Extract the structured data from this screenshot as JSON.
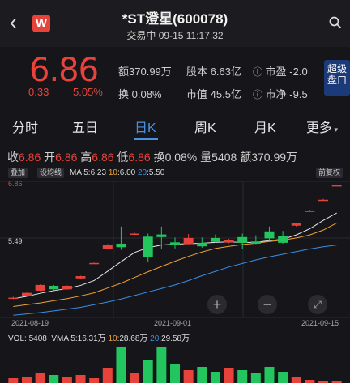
{
  "header": {
    "title": "*ST澄星(600078)",
    "subtitle": "交易中 09-15 11:17:32",
    "logo_text": "W"
  },
  "quote": {
    "price": "6.86",
    "change": "0.33",
    "change_pct": "5.05%",
    "amount_label": "额",
    "amount": "370.99万",
    "share_label": "股本",
    "shares": "6.63亿",
    "pe_label": "市盈",
    "pe": "-2.0",
    "turnover_label": "换",
    "turnover": "0.08%",
    "mcap_label": "市值",
    "mcap": "45.5亿",
    "pb_label": "市净",
    "pb": "-9.5",
    "margin_button": "超级盘口",
    "price_color": "#e8433b"
  },
  "tabs": [
    "分时",
    "五日",
    "日K",
    "周K",
    "月K",
    "更多"
  ],
  "active_tab": "日K",
  "ohlc": {
    "close_label": "收",
    "close": "6.86",
    "open_label": "开",
    "open": "6.86",
    "high_label": "高",
    "high": "6.86",
    "low_label": "低",
    "low": "6.86",
    "turnover_label": "换",
    "turnover": "0.08%",
    "volume_label": "量",
    "volume": "5408",
    "amount_label": "额",
    "amount": "370.99万"
  },
  "ma": {
    "chip1": "叠加",
    "chip2": "设均线",
    "label": "MA",
    "ma5_label": "5",
    "ma5": "6.23",
    "ma10_label": "10",
    "ma10": "6.00",
    "ma20_label": "20",
    "ma20": "5.50",
    "adjust": "前复权",
    "ma5_color": "#e8e8e8",
    "ma10_color": "#f0a030",
    "ma20_color": "#3a8ee6"
  },
  "chart_data": {
    "type": "candlestick",
    "y_labels": [
      "6.86",
      "5.49"
    ],
    "x_labels": [
      "2021-08-19",
      "2021-09-01",
      "2021-09-15"
    ],
    "candles": [
      {
        "o": 4.3,
        "c": 4.3,
        "h": 4.32,
        "l": 4.28
      },
      {
        "o": 4.33,
        "c": 4.41,
        "h": 4.42,
        "l": 4.32
      },
      {
        "o": 4.46,
        "c": 4.59,
        "h": 4.6,
        "l": 4.45
      },
      {
        "o": 4.57,
        "c": 4.49,
        "h": 4.59,
        "l": 4.47
      },
      {
        "o": 4.49,
        "c": 4.57,
        "h": 4.58,
        "l": 4.48
      },
      {
        "o": 4.74,
        "c": 4.79,
        "h": 4.8,
        "l": 4.73
      },
      {
        "o": 5.09,
        "c": 5.09,
        "h": 5.1,
        "l": 5.08
      },
      {
        "o": 5.4,
        "c": 5.51,
        "h": 5.52,
        "l": 5.4
      },
      {
        "o": 5.53,
        "c": 5.45,
        "h": 5.92,
        "l": 5.39
      },
      {
        "o": 5.76,
        "c": 5.76,
        "h": 5.78,
        "l": 5.74
      },
      {
        "o": 5.69,
        "c": 5.22,
        "h": 5.76,
        "l": 5.12
      },
      {
        "o": 5.74,
        "c": 5.68,
        "h": 5.92,
        "l": 5.4
      },
      {
        "o": 5.56,
        "c": 5.5,
        "h": 5.67,
        "l": 5.42
      },
      {
        "o": 5.52,
        "c": 5.66,
        "h": 5.75,
        "l": 5.5
      },
      {
        "o": 5.55,
        "c": 5.47,
        "h": 5.67,
        "l": 5.44
      },
      {
        "o": 5.66,
        "c": 5.57,
        "h": 5.74,
        "l": 5.55
      },
      {
        "o": 5.56,
        "c": 5.62,
        "h": 5.64,
        "l": 5.54
      },
      {
        "o": 5.68,
        "c": 5.55,
        "h": 5.76,
        "l": 5.4
      },
      {
        "o": 5.58,
        "c": 5.53,
        "h": 5.72,
        "l": 5.52
      },
      {
        "o": 5.81,
        "c": 5.65,
        "h": 5.92,
        "l": 5.6
      },
      {
        "o": 5.7,
        "c": 5.55,
        "h": 5.82,
        "l": 5.53
      },
      {
        "o": 5.94,
        "c": 5.99,
        "h": 6.0,
        "l": 5.92
      },
      {
        "o": 6.28,
        "c": 6.28,
        "h": 6.3,
        "l": 6.27
      },
      {
        "o": 6.53,
        "c": 6.53,
        "h": 6.55,
        "l": 6.52
      },
      {
        "o": 6.86,
        "c": 6.86,
        "h": 6.86,
        "l": 6.86
      }
    ],
    "ma5": [
      4.28,
      4.33,
      4.4,
      4.46,
      4.51,
      4.58,
      4.69,
      4.9,
      5.12,
      5.33,
      5.44,
      5.5,
      5.52,
      5.53,
      5.54,
      5.56,
      5.57,
      5.56,
      5.56,
      5.6,
      5.63,
      5.73,
      5.87,
      6.06,
      6.23
    ],
    "ma10": [
      4.1,
      4.14,
      4.18,
      4.23,
      4.28,
      4.34,
      4.41,
      4.52,
      4.63,
      4.76,
      4.89,
      5.01,
      5.13,
      5.24,
      5.34,
      5.42,
      5.47,
      5.51,
      5.54,
      5.58,
      5.61,
      5.66,
      5.73,
      5.84,
      6.0
    ],
    "ma20": [
      3.9,
      3.93,
      3.96,
      4.0,
      4.04,
      4.08,
      4.14,
      4.2,
      4.27,
      4.35,
      4.43,
      4.51,
      4.59,
      4.69,
      4.8,
      4.9,
      5.0,
      5.08,
      5.16,
      5.23,
      5.29,
      5.35,
      5.41,
      5.46,
      5.5
    ],
    "ylim": [
      3.85,
      6.95
    ],
    "up_color": "#e8433b",
    "down_color": "#22c55e"
  },
  "volume": {
    "label": "VOL:",
    "value": "5408",
    "vma_label": "VMA",
    "vma5_label": "5",
    "vma5": "16.31万",
    "vma10_label": "10",
    "vma10": "28.68万",
    "vma20_label": "20",
    "vma20": "29.58万",
    "bars": [
      3,
      4,
      6,
      5,
      4,
      5,
      3,
      9,
      22,
      6,
      14,
      22,
      12,
      8,
      10,
      7,
      9,
      8,
      6,
      10,
      7,
      4,
      2,
      1,
      1
    ]
  }
}
